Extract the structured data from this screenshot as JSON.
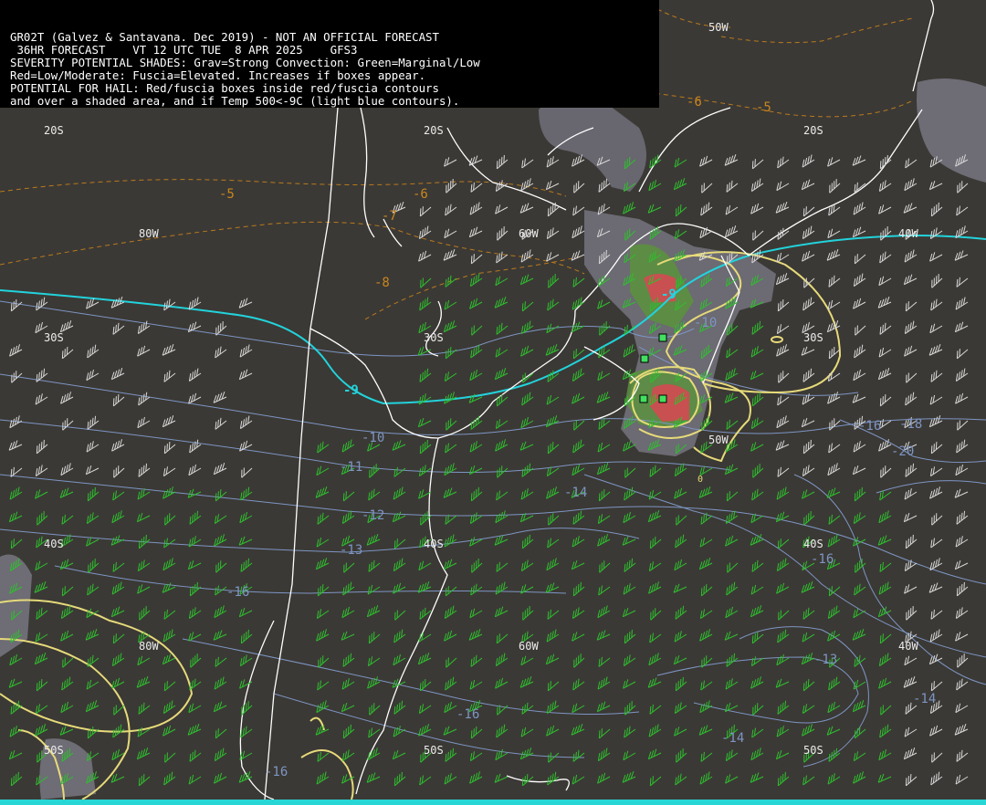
{
  "header": {
    "lines": [
      "GR02T (Galvez & Santavana. Dec 2019) - NOT AN OFFICIAL FORECAST",
      " 36HR FORECAST    VT 12 UTC TUE  8 APR 2025    GFS3",
      "SEVERITY POTENTIAL SHADES: Grav=Strong Convection: Green=Marginal/Low",
      "Red=Low/Moderate: Fuscia=Elevated. Increases if boxes appear.",
      "POTENTIAL FOR HAIL: Red/fuscia boxes inside red/fuscia contours",
      "and over a shaded area, and if Temp 500<-9C (light blue contours)."
    ]
  },
  "grid_labels": {
    "lat_20s": "20S",
    "lat_30s": "30S",
    "lat_40s": "40S",
    "lat_50s": "50S",
    "lon_80w": "80W",
    "lon_60w": "60W",
    "lon_50w": "50W",
    "lon_40w": "40W"
  },
  "contour_labels": {
    "orange": [
      "-5",
      "-6",
      "-6",
      "-5",
      "-7",
      "-8"
    ],
    "blue": [
      "-10",
      "-10",
      "-11",
      "-12",
      "-13",
      "-14",
      "-16",
      "-16",
      "-18",
      "-20",
      "-16",
      "-13",
      "-14",
      "-16",
      "-14",
      "-16"
    ],
    "cyan": [
      "-9",
      "-9"
    ],
    "yellow": [
      "0"
    ]
  },
  "colors": {
    "background": "#3b3935",
    "coastline": "#ffffff",
    "temp_minus9_contour": "#22d3dc",
    "temp_500_contours": "#7d95c4",
    "temp_warm_contours": "#b97a1e",
    "severity_contour": "#e6da7a",
    "wind_barbs_convection": "#2ec02e",
    "wind_barbs_other": "#d8d8d8",
    "shade_strong": "#7a7880",
    "shade_marginal": "#5c9040",
    "shade_moderate": "#c85050",
    "hail_box": "#42e060"
  },
  "hail_boxes_count": 4
}
